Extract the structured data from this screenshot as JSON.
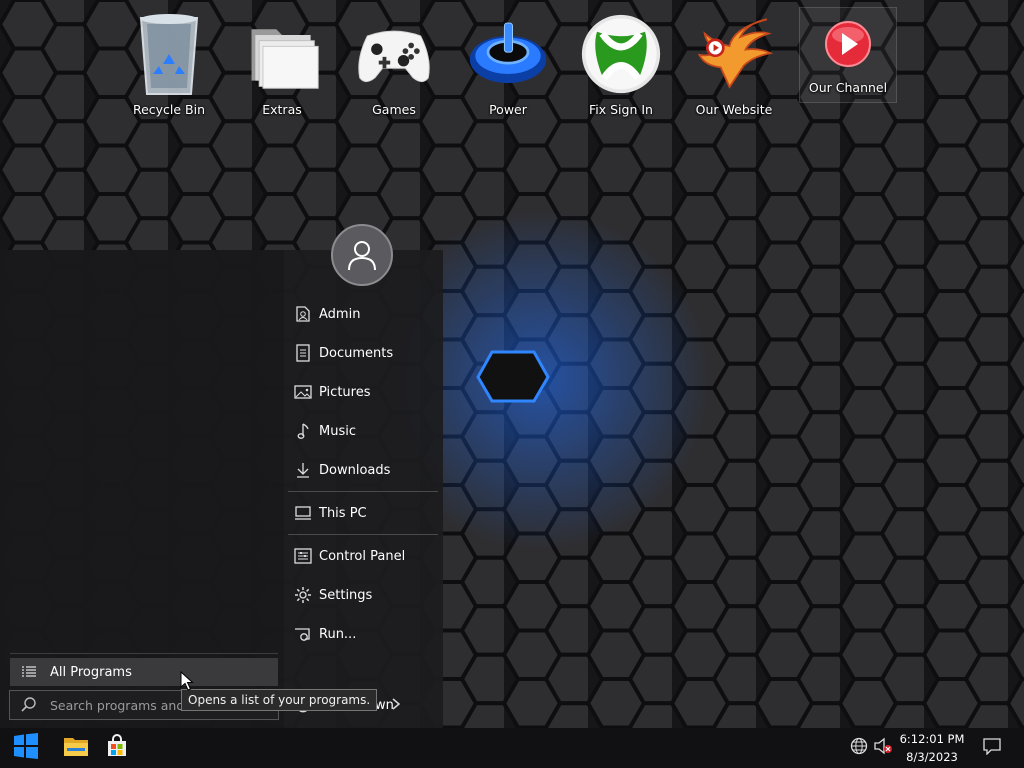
{
  "desktop": {
    "icons": [
      {
        "label": "Recycle Bin",
        "icon": "recycle-bin-icon"
      },
      {
        "label": "Extras",
        "icon": "folder-icon"
      },
      {
        "label": "Games",
        "icon": "gamepad-icon"
      },
      {
        "label": "Power",
        "icon": "power-icon"
      },
      {
        "label": "Fix Sign In",
        "icon": "xbox-icon"
      },
      {
        "label": "Our Website",
        "icon": "phoenix-icon"
      },
      {
        "label": "Our Channel",
        "icon": "play-icon"
      }
    ]
  },
  "start_menu": {
    "user_icon": "user-avatar-icon",
    "places": [
      {
        "label": "Admin",
        "icon": "user-folder-icon"
      },
      {
        "label": "Documents",
        "icon": "document-icon"
      },
      {
        "label": "Pictures",
        "icon": "picture-icon"
      },
      {
        "label": "Music",
        "icon": "music-note-icon"
      },
      {
        "label": "Downloads",
        "icon": "download-icon"
      },
      {
        "label": "This PC",
        "icon": "computer-icon"
      },
      {
        "label": "Control Panel",
        "icon": "control-panel-icon"
      },
      {
        "label": "Settings",
        "icon": "gear-icon"
      },
      {
        "label": "Run...",
        "icon": "run-icon"
      }
    ],
    "all_programs": {
      "label": "All Programs",
      "icon": "list-icon"
    },
    "search": {
      "placeholder": "Search programs and files",
      "icon": "search-icon"
    },
    "shutdown": {
      "label": "Shut Down",
      "visible_label": "own",
      "icon": "power-icon"
    },
    "tooltip": "Opens a list of your programs."
  },
  "taskbar": {
    "start_icon": "windows-logo-icon",
    "pinned": [
      {
        "name": "File Explorer",
        "icon": "file-explorer-icon"
      },
      {
        "name": "Microsoft Store",
        "icon": "store-icon"
      }
    ],
    "tray": {
      "network_icon": "globe-network-icon",
      "volume_icon": "volume-muted-icon",
      "time": "6:12:01 PM",
      "date": "8/3/2023",
      "notification_icon": "notification-icon"
    }
  },
  "colors": {
    "accent": "#1f6fff",
    "start_menu_bg": "#1c1c1e",
    "taskbar_bg": "#111113",
    "highlight": "#3a3a3d"
  }
}
